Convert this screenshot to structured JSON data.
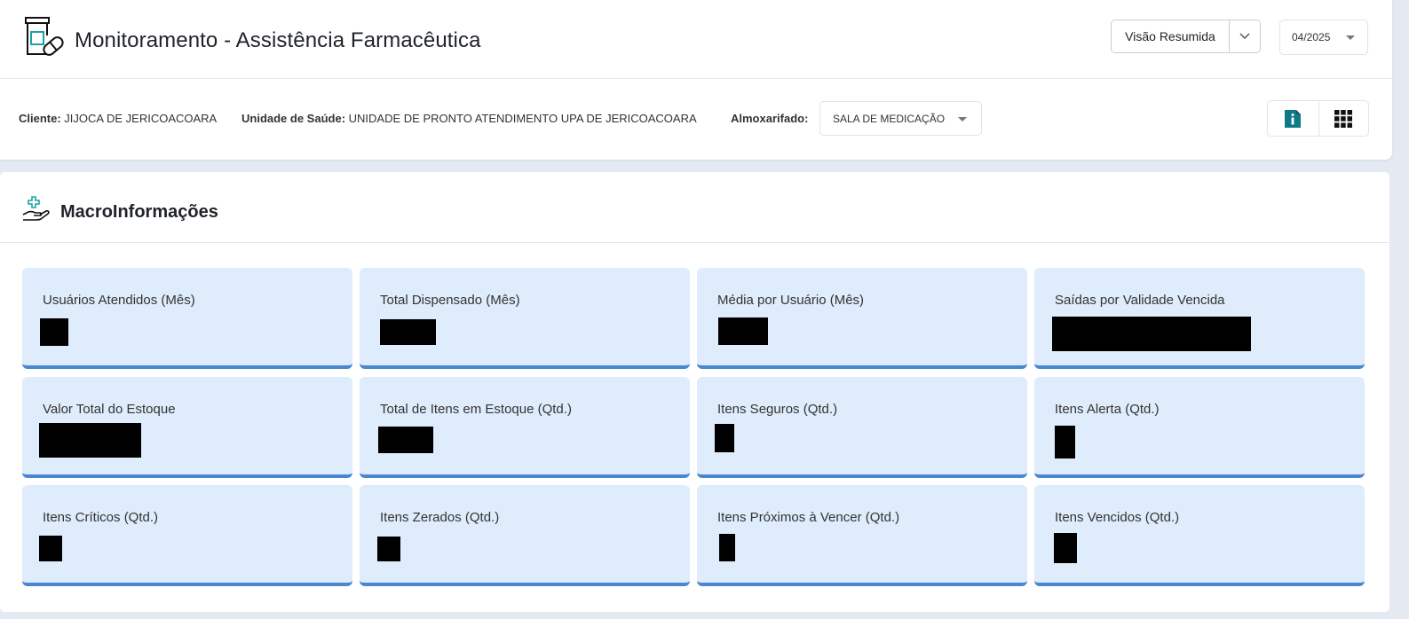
{
  "header": {
    "app_icon": "medicine-bottle-icon",
    "title": "Monitoramento - Assistência Farmacêutica",
    "view_selector": {
      "label": "Visão Resumida",
      "caret_icon": "chevron-down-icon"
    },
    "period_selector": {
      "value": "04/2025",
      "caret_icon": "triangle-down-icon"
    }
  },
  "filters": {
    "client": {
      "label": "Cliente:",
      "value": "JIJOCA DE JERICOACOARA"
    },
    "health_unit": {
      "label": "Unidade de Saúde:",
      "value": "UNIDADE DE PRONTO ATENDIMENTO UPA DE JERICOACOARA"
    },
    "warehouse": {
      "label": "Almoxarifado:",
      "value": "SALA DE MEDICAÇÃO"
    },
    "actions": [
      {
        "name": "info-document-icon",
        "color": "#0f7a86"
      },
      {
        "name": "grid-apps-icon",
        "color": "#111111"
      }
    ]
  },
  "macro": {
    "title": "MacroInformações",
    "icon": "hand-medical-cross-icon",
    "accent": "#4a87d1",
    "card_bg": "#deecfb",
    "cards": [
      {
        "label": "Usuários Atendidos (Mês)",
        "value": ""
      },
      {
        "label": "Total Dispensado (Mês)",
        "value": ""
      },
      {
        "label": "Média por Usuário (Mês)",
        "value": ""
      },
      {
        "label": "Saídas por Validade Vencida",
        "value": ""
      },
      {
        "label": "Valor Total do Estoque",
        "value": ""
      },
      {
        "label": "Total de Itens em Estoque (Qtd.)",
        "value": ""
      },
      {
        "label": "Itens Seguros (Qtd.)",
        "value": ""
      },
      {
        "label": "Itens Alerta (Qtd.)",
        "value": ""
      },
      {
        "label": "Itens Críticos (Qtd.)",
        "value": ""
      },
      {
        "label": "Itens Zerados (Qtd.)",
        "value": ""
      },
      {
        "label": "Itens Próximos à Vencer (Qtd.)",
        "value": ""
      },
      {
        "label": "Itens Vencidos (Qtd.)",
        "value": ""
      }
    ]
  }
}
